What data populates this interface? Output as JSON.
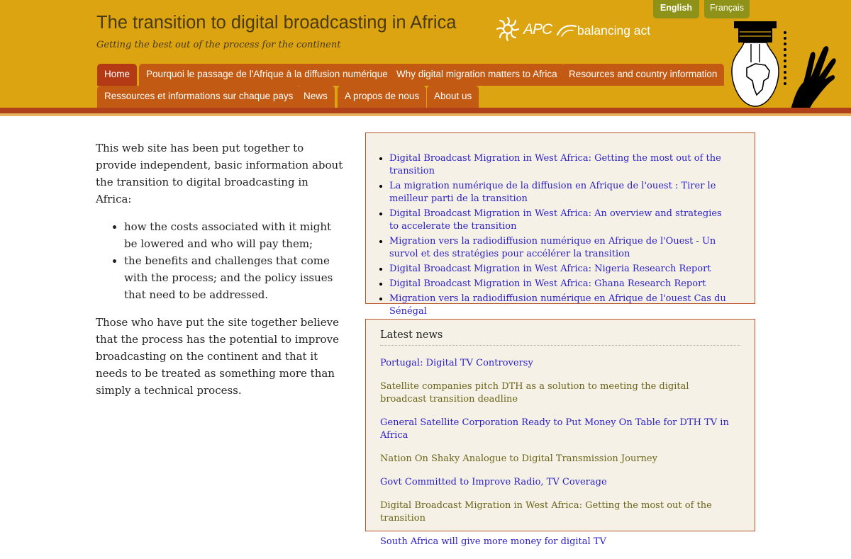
{
  "header": {
    "title": "The transition to digital broadcasting in Africa",
    "tagline": "Getting the best out of the process for the continent",
    "languages": [
      "English",
      "Français"
    ],
    "logos": {
      "apc": "APC",
      "balancing_act": "balancing act"
    }
  },
  "nav": {
    "tabs": [
      "Home",
      "Pourquoi le passage de l'Afrique à la diffusion numérique",
      "Why digital migration matters to Africa",
      "Resources and country information",
      "Ressources et informations sur chaque pays",
      "News",
      "A propos de nous",
      "About us"
    ]
  },
  "intro": {
    "paragraph1": "This web site has been put together to provide independent, basic information about the transition to digital broadcasting in Africa:",
    "bullets": [
      "how the costs associated with it might be lowered and who will pay them;",
      "the benefits and challenges that come with the process; and the policy issues that need to be addressed."
    ],
    "paragraph2": "Those who have put the site together believe that the process has the potential to improve broadcasting on the continent and that it needs to be treated as something more than simply a technical process."
  },
  "featured_links": [
    "Digital Broadcast Migration in West Africa: Getting the most out of the transition",
    "La migration numérique de la diffusion en Afrique de l'ouest : Tirer le meilleur parti de la transition",
    "Digital Broadcast Migration in West Africa: An overview and strategies to accelerate the transition",
    "Migration vers la radiodiffusion numérique en Afrique de l'Ouest - Un survol et des stratégies pour accélérer la transition",
    "Digital Broadcast Migration in West Africa: Nigeria Research Report",
    "Digital Broadcast Migration in West Africa: Ghana Research Report",
    "Migration vers la radiodiffusion numérique en Afrique de l'ouest Cas du Sénégal"
  ],
  "latest_news": {
    "heading": "Latest news",
    "items": [
      "Portugal: Digital TV Controversy",
      "Satellite companies pitch DTH as a solution to meeting the digital broadcast transition deadline",
      "General Satellite Corporation Ready to Put Money On Table for DTH TV in Africa",
      "Nation On Shaky Analogue to Digital Transmission Journey",
      "Govt Committed to Improve Radio, TV Coverage",
      "Digital Broadcast Migration in West Africa: Getting the most out of the transition",
      "South Africa will give more money for digital TV"
    ]
  },
  "colors": {
    "header_bg": "#dca410",
    "tab_bg": "#c35a13",
    "rule": "#b0401a",
    "link": "#2a1ec6",
    "news_alt": "#6b6418",
    "box_bg": "#f5f1e6"
  }
}
